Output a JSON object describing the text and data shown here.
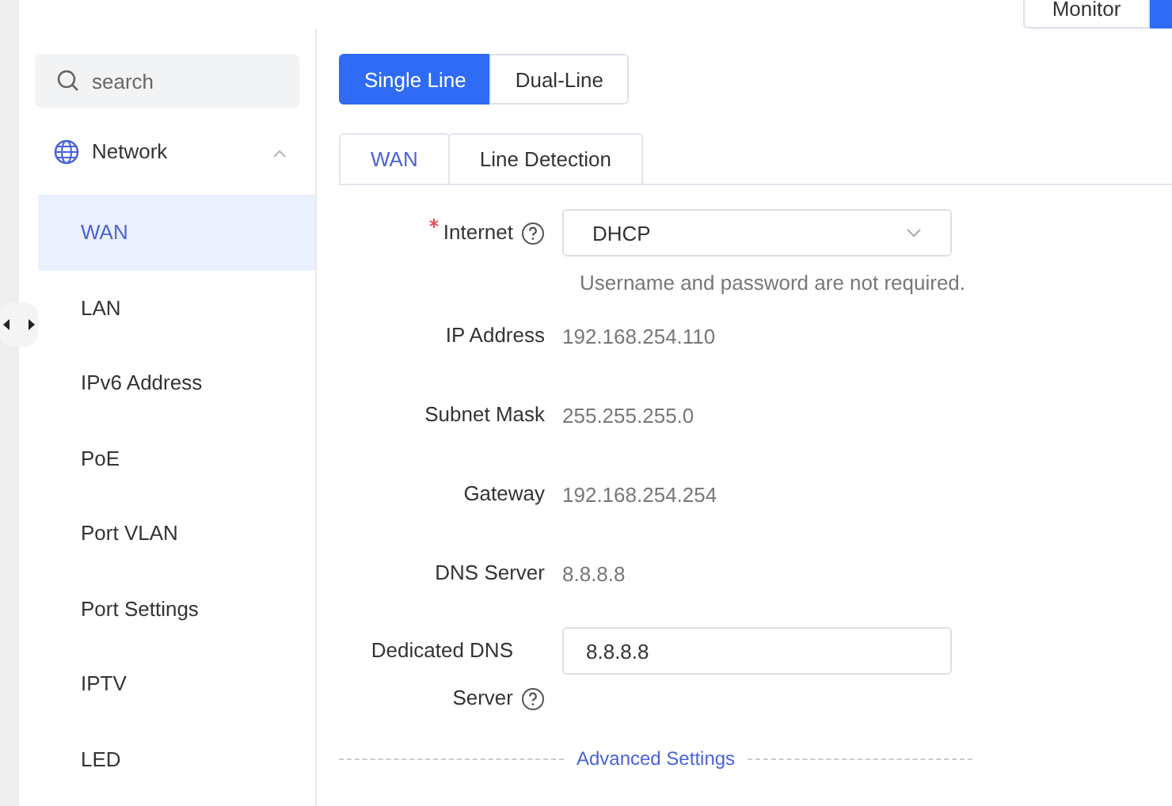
{
  "top_bar": {
    "monitor_button": "Monitor"
  },
  "sidebar": {
    "search": {
      "placeholder": "search"
    },
    "groups": [
      {
        "label": "Network",
        "expanded": true,
        "children": [
          {
            "label": "WAN",
            "selected": true
          },
          {
            "label": "LAN",
            "selected": false
          },
          {
            "label": "IPv6 Address",
            "selected": false
          },
          {
            "label": "PoE",
            "selected": false
          },
          {
            "label": "Port VLAN",
            "selected": false
          },
          {
            "label": "Port Settings",
            "selected": false
          },
          {
            "label": "IPTV",
            "selected": false
          },
          {
            "label": "LED",
            "selected": false
          }
        ]
      }
    ]
  },
  "line_mode": [
    {
      "label": "Single Line",
      "selected": true
    },
    {
      "label": "Dual-Line",
      "selected": false
    }
  ],
  "tabs": [
    {
      "label": "WAN",
      "selected": true
    },
    {
      "label": "Line Detection",
      "selected": false
    }
  ],
  "form": [
    {
      "kind": "select",
      "label": "Internet",
      "required": true,
      "help": true,
      "value": "DHCP"
    },
    {
      "kind": "hint",
      "text": "Username and password are not required."
    },
    {
      "kind": "text",
      "label": "IP Address",
      "value": "192.168.254.110"
    },
    {
      "kind": "text",
      "label": "Subnet Mask",
      "value": "255.255.255.0"
    },
    {
      "kind": "text",
      "label": "Gateway",
      "value": "192.168.254.254"
    },
    {
      "kind": "text",
      "label": "DNS Server",
      "value": "8.8.8.8"
    },
    {
      "kind": "input",
      "label": "Dedicated DNS Server",
      "help": true,
      "value": "8.8.8.8"
    }
  ],
  "advanced_link": "Advanced Settings"
}
